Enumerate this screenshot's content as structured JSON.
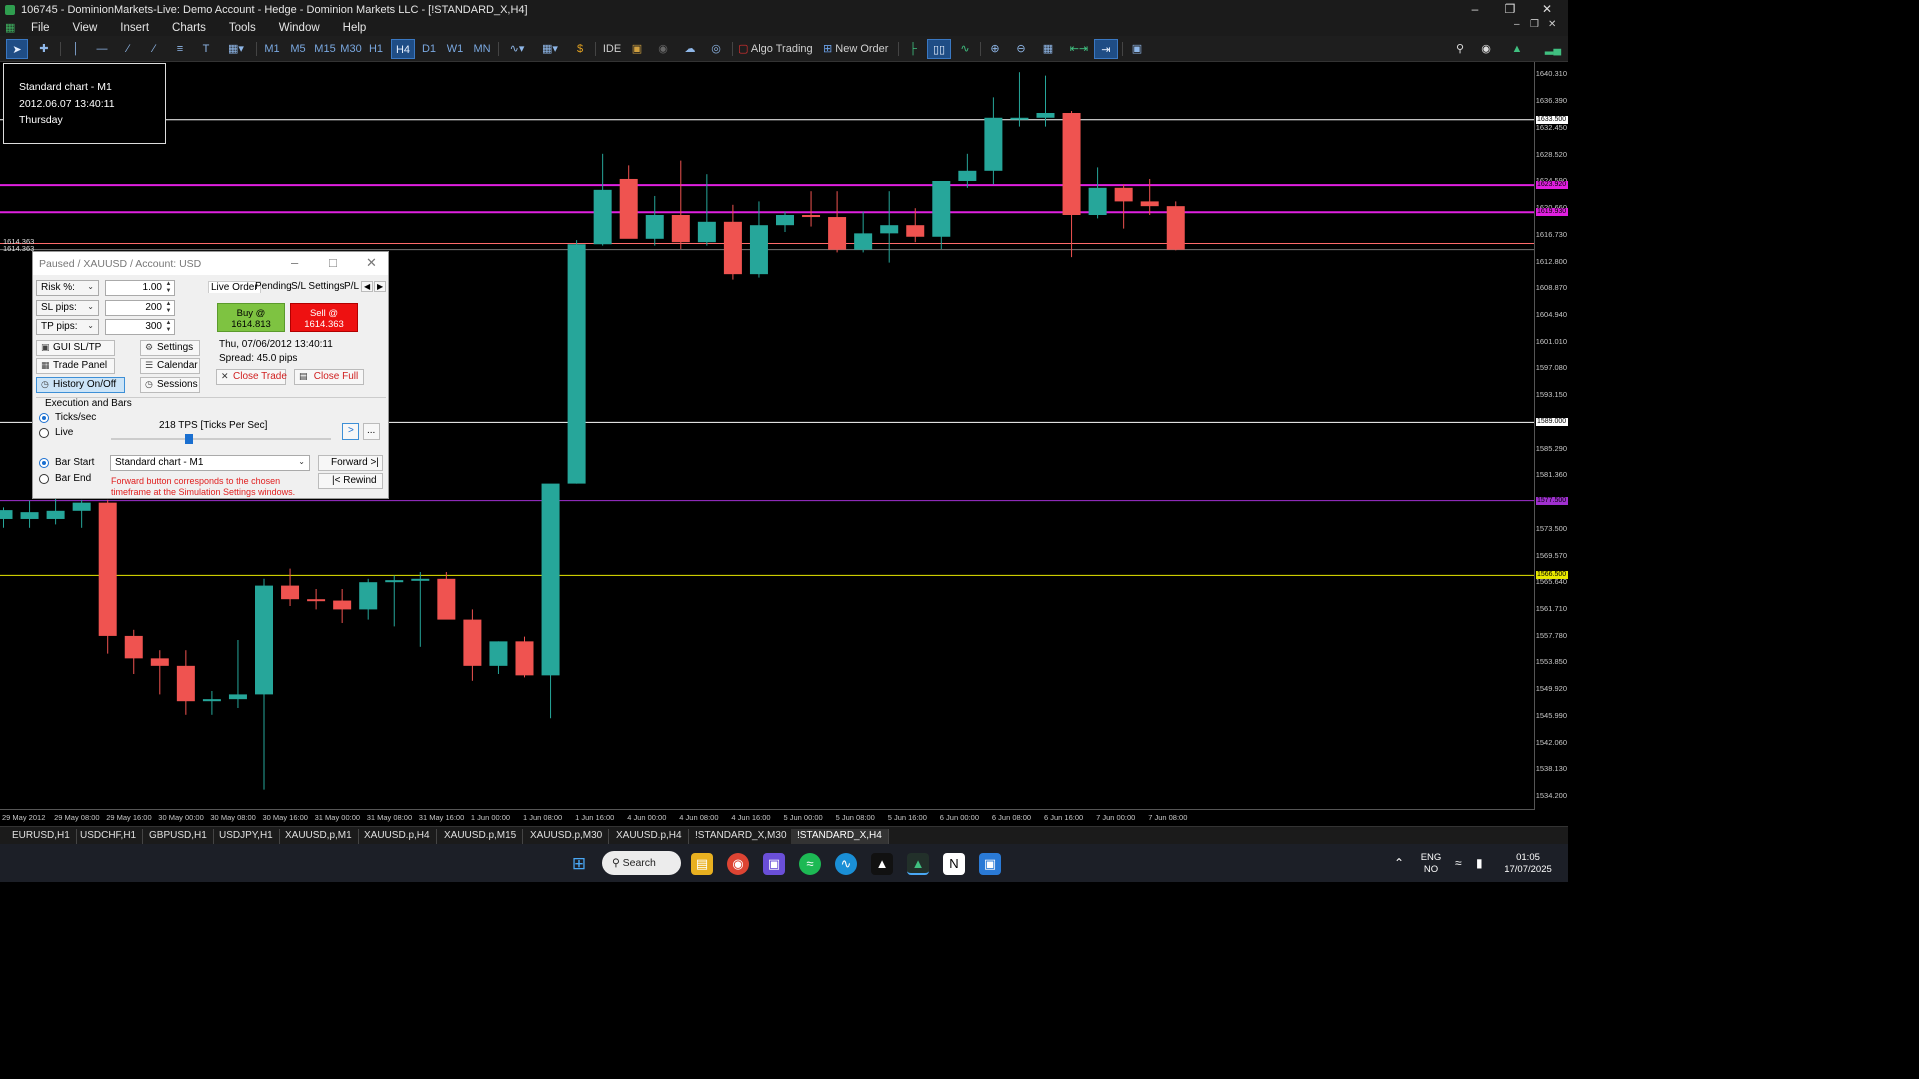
{
  "window": {
    "title": "106745 - DominionMarkets-Live: Demo Account - Hedge - Dominion Markets LLC - [!STANDARD_X,H4]"
  },
  "menu": [
    "File",
    "View",
    "Insert",
    "Charts",
    "Tools",
    "Window",
    "Help"
  ],
  "toolbar": {
    "timeframes": [
      "M1",
      "M5",
      "M15",
      "M30",
      "H1",
      "H4",
      "D1",
      "W1",
      "MN"
    ],
    "active_timeframe": "H4",
    "ide_label": "IDE",
    "algo_trading_label": "Algo Trading",
    "new_order_label": "New Order"
  },
  "info_box": {
    "line1": "Standard chart - M1",
    "line2": "2012.06.07 13:40:11",
    "line3": "Thursday"
  },
  "left_price_label": "1614.363",
  "panel": {
    "title": "Paused / XAUUSD / Account: USD",
    "risk_label": "Risk %:",
    "risk_value": "1.00",
    "sl_label": "SL pips:",
    "sl_value": "200",
    "tp_label": "TP pips:",
    "tp_value": "300",
    "gui_sltp": "GUI SL/TP",
    "settings": "Settings",
    "trade_panel": "Trade Panel",
    "calendar": "Calendar",
    "history": "History On/Off",
    "sessions": "Sessions",
    "tabs": [
      "Live Order",
      "Pending",
      "S/L Settings",
      "P/L"
    ],
    "buy_label": "Buy @",
    "buy_price": "1614.813",
    "sell_label": "Sell @",
    "sell_price": "1614.363",
    "datetime": "Thu, 07/06/2012  13:40:11",
    "spread": "Spread: 45.0 pips",
    "close_trade": "Close Trade",
    "close_full": "Close Full",
    "exec_section": "Execution and Bars",
    "ticks_label": "Ticks/sec",
    "live_label": "Live",
    "tps_label": "218 TPS [Ticks Per Sec]",
    "next_btn": ">",
    "more_btn": "...",
    "bar_start": "Bar Start",
    "bar_end": "Bar End",
    "chart_select": "Standard chart - M1",
    "forward": "Forward >|",
    "rewind": "|< Rewind",
    "warning": "Forward button corresponds to the chosen timeframe at the Simulation Settings windows."
  },
  "price_axis": {
    "ticks": [
      "1640.310",
      "1636.390",
      "1632.450",
      "1628.520",
      "1624.590",
      "1620.660",
      "1616.730",
      "1612.800",
      "1608.870",
      "1604.940",
      "1601.010",
      "1597.080",
      "1593.150",
      "1589.000",
      "1585.290",
      "1581.360",
      "1577.430",
      "1573.500",
      "1569.570",
      "1565.640",
      "1561.710",
      "1557.780",
      "1553.850",
      "1549.920",
      "1545.990",
      "1542.060",
      "1538.130",
      "1534.200"
    ],
    "labels": [
      {
        "text": "1633.500",
        "color": "#ffffff"
      },
      {
        "text": "1623.920",
        "color": "#e020e0"
      },
      {
        "text": "1619.930",
        "color": "#e020e0"
      },
      {
        "text": "1589.000",
        "color": "#ffffff"
      },
      {
        "text": "1577.500",
        "color": "#a030d0"
      },
      {
        "text": "1566.500",
        "color": "#e8e800"
      }
    ]
  },
  "time_axis": [
    "29 May 2012",
    "29 May 08:00",
    "29 May 16:00",
    "30 May 00:00",
    "30 May 08:00",
    "30 May 16:00",
    "31 May 00:00",
    "31 May 08:00",
    "31 May 16:00",
    "1 Jun 00:00",
    "1 Jun 08:00",
    "1 Jun 16:00",
    "4 Jun 00:00",
    "4 Jun 08:00",
    "4 Jun 16:00",
    "5 Jun 00:00",
    "5 Jun 08:00",
    "5 Jun 16:00",
    "6 Jun 00:00",
    "6 Jun 08:00",
    "6 Jun 16:00",
    "7 Jun 00:00",
    "7 Jun 08:00"
  ],
  "chart_data": {
    "type": "candlestick",
    "ylim": [
      1532.0,
      1642.0
    ],
    "bull_color": "#26a69a",
    "bear_color": "#ef5350",
    "hlines": [
      {
        "price": 1633.5,
        "color": "#ffffff"
      },
      {
        "price": 1623.9,
        "color": "#e020e0"
      },
      {
        "price": 1619.9,
        "color": "#e020e0"
      },
      {
        "price": 1615.3,
        "color": "#ff6b6b"
      },
      {
        "price": 1614.4,
        "color": "#777777"
      },
      {
        "price": 1589.0,
        "color": "#ffffff"
      },
      {
        "price": 1577.5,
        "color": "#a030d0"
      },
      {
        "price": 1566.5,
        "color": "#e8e800"
      }
    ],
    "candles": [
      {
        "o": 1574.8,
        "h": 1576.5,
        "l": 1573.5,
        "c": 1576.1
      },
      {
        "o": 1574.8,
        "h": 1577.5,
        "l": 1573.5,
        "c": 1575.8
      },
      {
        "o": 1574.8,
        "h": 1578.0,
        "l": 1574.0,
        "c": 1576.0
      },
      {
        "o": 1576.0,
        "h": 1577.6,
        "l": 1573.5,
        "c": 1577.2
      },
      {
        "o": 1577.2,
        "h": 1577.6,
        "l": 1555.0,
        "c": 1557.6
      },
      {
        "o": 1557.6,
        "h": 1558.5,
        "l": 1552.0,
        "c": 1554.3
      },
      {
        "o": 1554.3,
        "h": 1555.5,
        "l": 1549.0,
        "c": 1553.2
      },
      {
        "o": 1553.2,
        "h": 1555.5,
        "l": 1546.0,
        "c": 1548.0
      },
      {
        "o": 1548.0,
        "h": 1549.5,
        "l": 1546.0,
        "c": 1548.3
      },
      {
        "o": 1548.3,
        "h": 1557.0,
        "l": 1547.0,
        "c": 1549.0
      },
      {
        "o": 1549.0,
        "h": 1566.0,
        "l": 1535.0,
        "c": 1565.0
      },
      {
        "o": 1565.0,
        "h": 1567.5,
        "l": 1562.0,
        "c": 1563.0
      },
      {
        "o": 1563.0,
        "h": 1564.5,
        "l": 1561.5,
        "c": 1562.8
      },
      {
        "o": 1562.8,
        "h": 1564.5,
        "l": 1559.5,
        "c": 1561.5
      },
      {
        "o": 1561.5,
        "h": 1566.0,
        "l": 1560.0,
        "c": 1565.5
      },
      {
        "o": 1565.5,
        "h": 1566.5,
        "l": 1559.0,
        "c": 1565.8
      },
      {
        "o": 1565.8,
        "h": 1567.0,
        "l": 1556.0,
        "c": 1566.0
      },
      {
        "o": 1566.0,
        "h": 1567.0,
        "l": 1561.0,
        "c": 1560.0
      },
      {
        "o": 1560.0,
        "h": 1561.5,
        "l": 1551.0,
        "c": 1553.2
      },
      {
        "o": 1553.2,
        "h": 1556.8,
        "l": 1552.0,
        "c": 1556.8
      },
      {
        "o": 1556.8,
        "h": 1557.5,
        "l": 1551.5,
        "c": 1551.8
      },
      {
        "o": 1551.8,
        "h": 1570.0,
        "l": 1545.5,
        "c": 1580.0
      },
      {
        "o": 1580.0,
        "h": 1615.8,
        "l": 1580.0,
        "c": 1615.2
      },
      {
        "o": 1615.2,
        "h": 1628.5,
        "l": 1615.0,
        "c": 1623.2
      },
      {
        "o": 1624.8,
        "h": 1626.8,
        "l": 1616.8,
        "c": 1616.0
      },
      {
        "o": 1616.0,
        "h": 1622.3,
        "l": 1615.0,
        "c": 1619.5
      },
      {
        "o": 1619.5,
        "h": 1627.5,
        "l": 1614.5,
        "c": 1615.5
      },
      {
        "o": 1615.5,
        "h": 1625.5,
        "l": 1615.0,
        "c": 1618.5
      },
      {
        "o": 1618.5,
        "h": 1621.0,
        "l": 1610.0,
        "c": 1610.8
      },
      {
        "o": 1610.8,
        "h": 1621.5,
        "l": 1610.3,
        "c": 1618.0
      },
      {
        "o": 1618.0,
        "h": 1620.0,
        "l": 1617.0,
        "c": 1619.5
      },
      {
        "o": 1619.5,
        "h": 1623.0,
        "l": 1617.8,
        "c": 1619.2
      },
      {
        "o": 1619.2,
        "h": 1623.0,
        "l": 1614.0,
        "c": 1614.4
      },
      {
        "o": 1614.4,
        "h": 1620.0,
        "l": 1614.0,
        "c": 1616.8
      },
      {
        "o": 1616.8,
        "h": 1623.0,
        "l": 1612.5,
        "c": 1618.0
      },
      {
        "o": 1618.0,
        "h": 1620.5,
        "l": 1615.5,
        "c": 1616.3
      },
      {
        "o": 1616.3,
        "h": 1624.5,
        "l": 1614.5,
        "c": 1624.5
      },
      {
        "o": 1624.5,
        "h": 1628.5,
        "l": 1623.5,
        "c": 1626.0
      },
      {
        "o": 1626.0,
        "h": 1636.8,
        "l": 1624.0,
        "c": 1633.8
      },
      {
        "o": 1633.8,
        "h": 1640.5,
        "l": 1632.5,
        "c": 1633.8
      },
      {
        "o": 1633.8,
        "h": 1640.0,
        "l": 1632.5,
        "c": 1634.5
      },
      {
        "o": 1634.5,
        "h": 1634.8,
        "l": 1613.3,
        "c": 1619.5
      },
      {
        "o": 1619.5,
        "h": 1626.5,
        "l": 1619.0,
        "c": 1623.5
      },
      {
        "o": 1623.5,
        "h": 1624.0,
        "l": 1617.5,
        "c": 1621.5
      },
      {
        "o": 1621.5,
        "h": 1624.8,
        "l": 1619.5,
        "c": 1620.8
      },
      {
        "o": 1620.8,
        "h": 1621.5,
        "l": 1614.3,
        "c": 1614.4
      }
    ]
  },
  "tabs": [
    "EURUSD,H1",
    "USDCHF,H1",
    "GBPUSD,H1",
    "USDJPY,H1",
    "XAUUSD,p,M1",
    "XAUUSD.p,H4",
    "XAUUSD.p,M15",
    "XAUUSD.p,M30",
    "XAUUSD.p,H4",
    "!STANDARD_X,M30",
    "!STANDARD_X,H4"
  ],
  "active_tab": "!STANDARD_X,H4",
  "taskbar": {
    "search": "Search",
    "lang1": "ENG",
    "lang2": "NO",
    "time": "01:05",
    "date": "17/07/2025"
  }
}
